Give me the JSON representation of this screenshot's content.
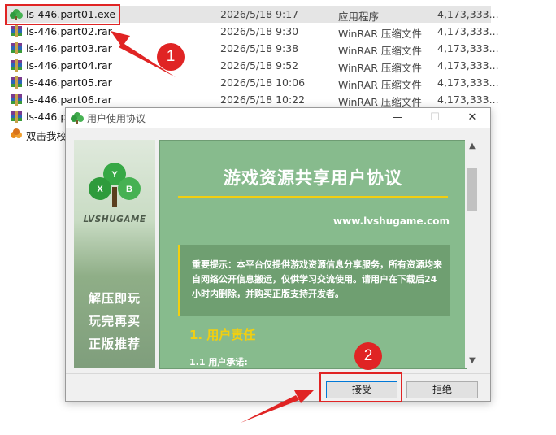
{
  "files": [
    {
      "name": "ls-446.part01.exe",
      "date": "2026/5/18 9:17",
      "type": "应用程序",
      "size": "4,173,333...",
      "icon": "exe-icon",
      "selected": true
    },
    {
      "name": "ls-446.part02.rar",
      "date": "2026/5/18 9:30",
      "type": "WinRAR 压缩文件",
      "size": "4,173,333...",
      "icon": "rar-icon"
    },
    {
      "name": "ls-446.part03.rar",
      "date": "2026/5/18 9:38",
      "type": "WinRAR 压缩文件",
      "size": "4,173,333...",
      "icon": "rar-icon"
    },
    {
      "name": "ls-446.part04.rar",
      "date": "2026/5/18 9:52",
      "type": "WinRAR 压缩文件",
      "size": "4,173,333...",
      "icon": "rar-icon"
    },
    {
      "name": "ls-446.part05.rar",
      "date": "2026/5/18 10:06",
      "type": "WinRAR 压缩文件",
      "size": "4,173,333...",
      "icon": "rar-icon"
    },
    {
      "name": "ls-446.part06.rar",
      "date": "2026/5/18 10:22",
      "type": "WinRAR 压缩文件",
      "size": "4,173,333...",
      "icon": "rar-icon"
    },
    {
      "name": "ls-446.pa",
      "date": "",
      "type": "",
      "size": "",
      "icon": "rar-icon"
    },
    {
      "name": "双击我校",
      "date": "",
      "type": "",
      "size": "",
      "icon": "shortcut-icon"
    }
  ],
  "dialog": {
    "title": "用户使用协议",
    "brand": "LVSHUGAME",
    "logo_letters": [
      "Y",
      "X",
      "B"
    ],
    "slogans": [
      "解压即玩",
      "玩完再买",
      "正版推荐"
    ],
    "content_title": "游戏资源共享用户协议",
    "url": "www.lvshugame.com",
    "notice": "重要提示：本平台仅提供游戏资源信息分享服务，所有资源均来自网络公开信息搬运，仅供学习交流使用。请用户在下载后24小时内删除，并购买正版支持开发者。",
    "section_title": "1. 用户责任",
    "subsection": "1.1 用户承诺:",
    "accept_label": "接受",
    "decline_label": "拒绝"
  },
  "annotations": {
    "badge1": "1",
    "badge2": "2"
  },
  "colors": {
    "accent_red": "#e02424",
    "content_green": "#87bb8d",
    "title_yellow": "#f2cf10"
  }
}
